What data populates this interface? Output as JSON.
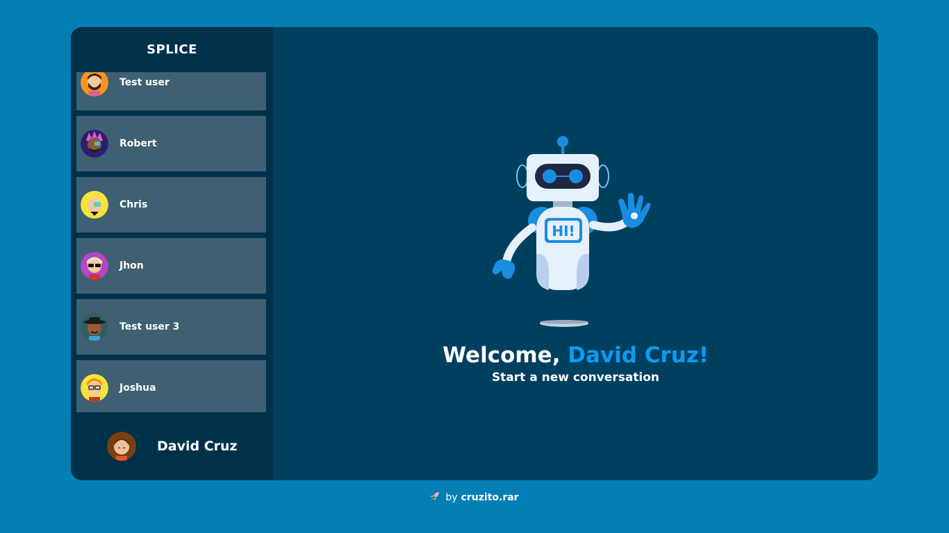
{
  "app": {
    "title": "SPLICE"
  },
  "contacts": [
    {
      "name": "Test user",
      "avatar": "avatar-bearded-man-orange"
    },
    {
      "name": "Robert",
      "avatar": "avatar-punk-pink-hair"
    },
    {
      "name": "Chris",
      "avatar": "avatar-blond-eyepatch"
    },
    {
      "name": "Jhon",
      "avatar": "avatar-sunglasses-purple"
    },
    {
      "name": "Test user 3",
      "avatar": "avatar-hat-man"
    },
    {
      "name": "Joshua",
      "avatar": "avatar-glasses-red-hair"
    }
  ],
  "current_user": {
    "name": "David Cruz",
    "avatar": "avatar-david"
  },
  "welcome": {
    "prefix": "Welcome, ",
    "name": "David Cruz!",
    "subtitle": "Start a new conversation",
    "robot_badge": "HI!"
  },
  "footer": {
    "prefix": "by",
    "author": "cruzito.rar",
    "icon": "rocket-icon"
  },
  "colors": {
    "background": "#037fb6",
    "panel": "#00405f",
    "sidebar": "#00314b",
    "contact_card": "#3f6072",
    "accent": "#0a9cf4"
  }
}
